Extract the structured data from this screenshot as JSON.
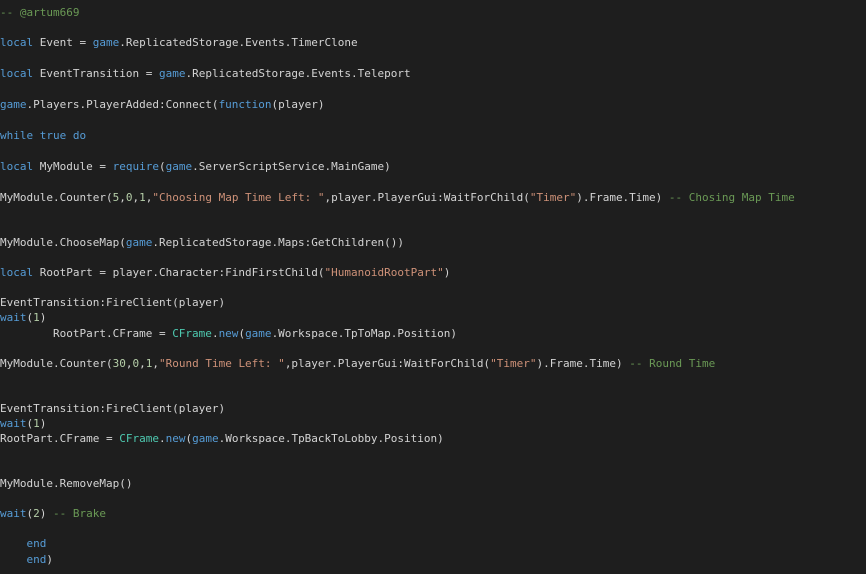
{
  "editor": {
    "lines": [
      [
        [
          "cmt",
          "-- @artum669"
        ]
      ],
      [
        [
          "kw",
          "local"
        ],
        [
          "plain",
          " Event = "
        ],
        [
          "kw",
          "game"
        ],
        [
          "plain",
          ".ReplicatedStorage.Events.TimerClone"
        ]
      ],
      [
        [
          "kw",
          "local"
        ],
        [
          "plain",
          " EventTransition = "
        ],
        [
          "kw",
          "game"
        ],
        [
          "plain",
          ".ReplicatedStorage.Events.Teleport"
        ]
      ],
      [
        [
          "kw",
          "game"
        ],
        [
          "plain",
          ".Players.PlayerAdded:Connect("
        ],
        [
          "kw",
          "function"
        ],
        [
          "plain",
          "(player)"
        ]
      ],
      [
        [
          "kw",
          "while"
        ],
        [
          "plain",
          " "
        ],
        [
          "kw",
          "true"
        ],
        [
          "plain",
          " "
        ],
        [
          "kw",
          "do"
        ]
      ],
      [
        [
          "kw",
          "local"
        ],
        [
          "plain",
          " MyModule = "
        ],
        [
          "kw",
          "require"
        ],
        [
          "plain",
          "("
        ],
        [
          "kw",
          "game"
        ],
        [
          "plain",
          ".ServerScriptService.MainGame)"
        ]
      ],
      [
        [
          "plain",
          "MyModule.Counter("
        ],
        [
          "num",
          "5"
        ],
        [
          "plain",
          ","
        ],
        [
          "num",
          "0"
        ],
        [
          "plain",
          ","
        ],
        [
          "num",
          "1"
        ],
        [
          "plain",
          ","
        ],
        [
          "str",
          "\"Choosing Map Time Left: \""
        ],
        [
          "plain",
          ",player.PlayerGui:WaitForChild("
        ],
        [
          "str",
          "\"Timer\""
        ],
        [
          "plain",
          ").Frame.Time) "
        ],
        [
          "cmt",
          "-- Chosing Map Time"
        ]
      ],
      [
        [
          "plain",
          "MyModule.ChooseMap("
        ],
        [
          "kw",
          "game"
        ],
        [
          "plain",
          ".ReplicatedStorage.Maps:GetChildren())"
        ]
      ],
      [
        [
          "kw",
          "local"
        ],
        [
          "plain",
          " RootPart = player.Character:FindFirstChild("
        ],
        [
          "str",
          "\"HumanoidRootPart\""
        ],
        [
          "plain",
          ")"
        ]
      ],
      [
        [
          "plain",
          "EventTransition:FireClient(player)"
        ]
      ],
      [
        [
          "kw",
          "wait"
        ],
        [
          "plain",
          "("
        ],
        [
          "num",
          "1"
        ],
        [
          "plain",
          ")"
        ]
      ],
      [
        [
          "plain",
          "        RootPart.CFrame = "
        ],
        [
          "builtin",
          "CFrame"
        ],
        [
          "plain",
          "."
        ],
        [
          "kw",
          "new"
        ],
        [
          "plain",
          "("
        ],
        [
          "kw",
          "game"
        ],
        [
          "plain",
          ".Workspace.TpToMap.Position)"
        ]
      ],
      [
        [
          "plain",
          "MyModule.Counter("
        ],
        [
          "num",
          "30"
        ],
        [
          "plain",
          ","
        ],
        [
          "num",
          "0"
        ],
        [
          "plain",
          ","
        ],
        [
          "num",
          "1"
        ],
        [
          "plain",
          ","
        ],
        [
          "str",
          "\"Round Time Left: \""
        ],
        [
          "plain",
          ",player.PlayerGui:WaitForChild("
        ],
        [
          "str",
          "\"Timer\""
        ],
        [
          "plain",
          ").Frame.Time) "
        ],
        [
          "cmt",
          "-- Round Time"
        ]
      ],
      [
        [
          "plain",
          "EventTransition:FireClient(player)"
        ]
      ],
      [
        [
          "kw",
          "wait"
        ],
        [
          "plain",
          "("
        ],
        [
          "num",
          "1"
        ],
        [
          "plain",
          ")"
        ]
      ],
      [
        [
          "plain",
          "RootPart.CFrame = "
        ],
        [
          "builtin",
          "CFrame"
        ],
        [
          "plain",
          "."
        ],
        [
          "kw",
          "new"
        ],
        [
          "plain",
          "("
        ],
        [
          "kw",
          "game"
        ],
        [
          "plain",
          ".Workspace.TpBackToLobby.Position)"
        ]
      ],
      [
        [
          "plain",
          "MyModule.RemoveMap()"
        ]
      ],
      [
        [
          "kw",
          "wait"
        ],
        [
          "plain",
          "("
        ],
        [
          "num",
          "2"
        ],
        [
          "plain",
          ") "
        ],
        [
          "cmt",
          "-- Brake"
        ]
      ],
      [
        [
          "plain",
          "    "
        ],
        [
          "kw",
          "end"
        ]
      ],
      [
        [
          "plain",
          "    "
        ],
        [
          "kw",
          "end"
        ],
        [
          "plain",
          ")"
        ]
      ]
    ]
  }
}
